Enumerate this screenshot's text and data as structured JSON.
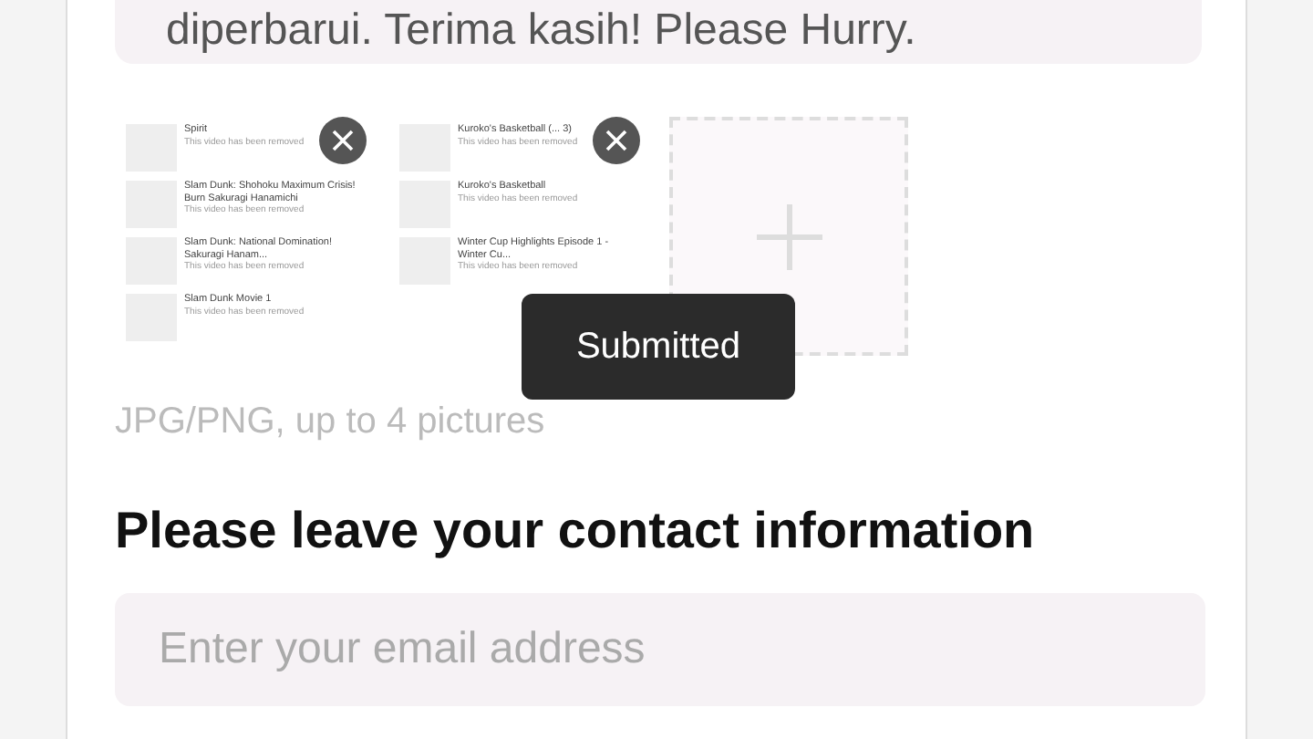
{
  "description_field": {
    "value": "diperbarui. Terima kasih! Please Hurry."
  },
  "pictures": [
    {
      "rows": [
        {
          "title": "Spirit",
          "subtitle": "This video has been removed"
        },
        {
          "title": "Slam Dunk: Shohoku Maximum Crisis! Burn Sakuragi Hanamichi",
          "subtitle": "This video has been removed"
        },
        {
          "title": "Slam Dunk: National Domination! Sakuragi Hanam...",
          "subtitle": "This video has been removed"
        },
        {
          "title": "Slam Dunk Movie 1",
          "subtitle": "This video has been removed"
        }
      ]
    },
    {
      "rows": [
        {
          "title": "Kuroko's Basketball (... 3)",
          "subtitle": "This video has been removed"
        },
        {
          "title": "Kuroko's Basketball",
          "subtitle": "This video has been removed"
        },
        {
          "title": "Winter Cup Highlights Episode 1 - Winter Cu...",
          "subtitle": "This video has been removed"
        }
      ]
    }
  ],
  "upload_hint": "JPG/PNG, up to 4 pictures",
  "contact_heading": "Please leave your contact information",
  "email_field": {
    "placeholder": "Enter your email address"
  },
  "toast": "Submitted"
}
